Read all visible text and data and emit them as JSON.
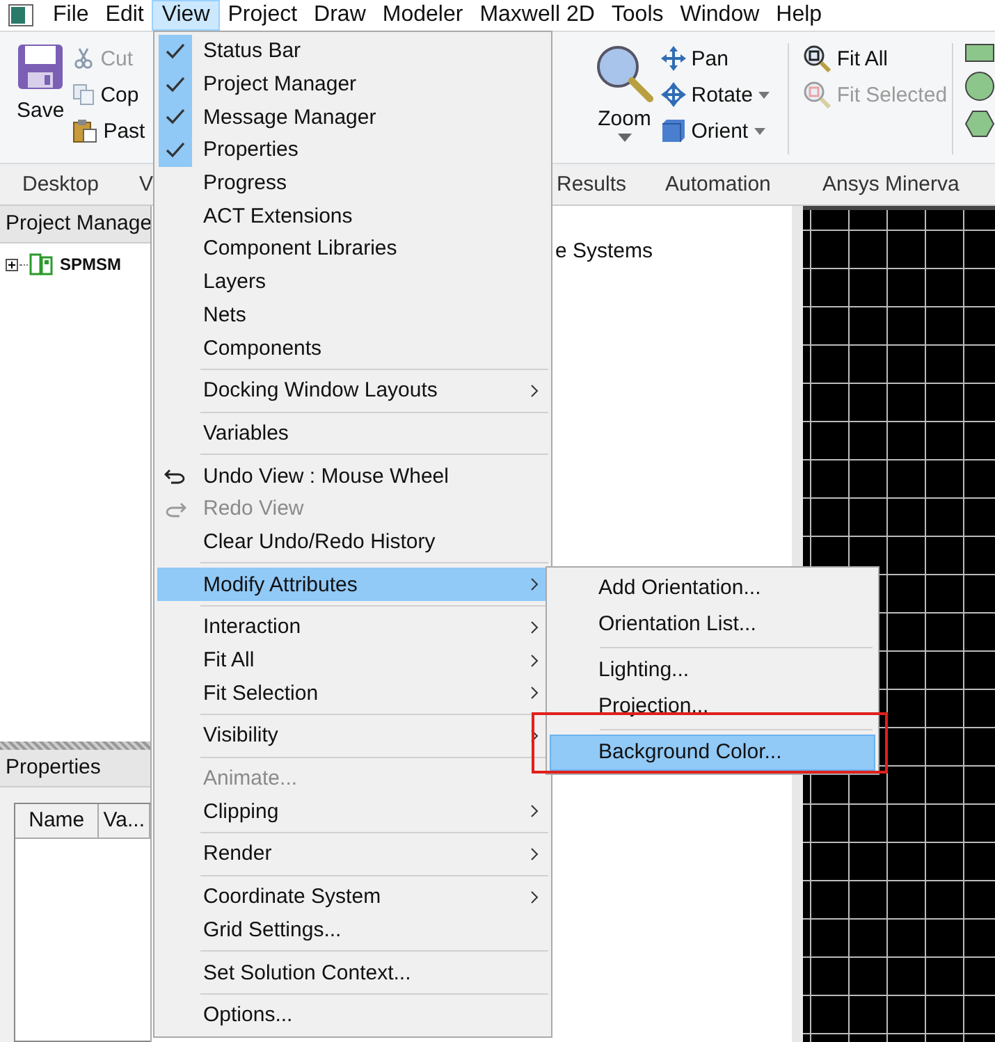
{
  "menu_bar": [
    {
      "label": "File",
      "selected": false
    },
    {
      "label": "Edit",
      "selected": false
    },
    {
      "label": "View",
      "selected": true
    },
    {
      "label": "Project",
      "selected": false
    },
    {
      "label": "Draw",
      "selected": false
    },
    {
      "label": "Modeler",
      "selected": false
    },
    {
      "label": "Maxwell 2D",
      "selected": false
    },
    {
      "label": "Tools",
      "selected": false
    },
    {
      "label": "Window",
      "selected": false
    },
    {
      "label": "Help",
      "selected": false
    }
  ],
  "ribbon": {
    "save": "Save",
    "clipboard": [
      {
        "label": "Cut",
        "disabled": true
      },
      {
        "label": "Cop",
        "disabled": false
      },
      {
        "label": "Past",
        "disabled": false
      }
    ],
    "zoom": {
      "label": "Zoom",
      "dropdown": true
    },
    "navigate": [
      {
        "label": "Pan",
        "dropdown": false
      },
      {
        "label": "Rotate",
        "dropdown": true
      },
      {
        "label": "Orient",
        "dropdown": true
      }
    ],
    "fit": [
      {
        "label": "Fit All",
        "disabled": false
      },
      {
        "label": "Fit Selected",
        "disabled": true
      }
    ]
  },
  "ribbon_tabs": [
    "Desktop",
    "V",
    "Results",
    "Automation",
    "Ansys Minerva"
  ],
  "project_manager": {
    "title": "Project Manage",
    "tree": [
      {
        "label": "SPMSM",
        "expanded": false
      }
    ]
  },
  "canvas_text": "e Systems",
  "properties": {
    "title": "Properties",
    "columns": [
      "Name",
      "Va..."
    ]
  },
  "view_menu": [
    {
      "kind": "check",
      "label": "Status Bar",
      "checked": true,
      "disabled": false,
      "submenu": false,
      "selected": false
    },
    {
      "kind": "check",
      "label": "Project Manager",
      "checked": true,
      "disabled": false,
      "submenu": false,
      "selected": false
    },
    {
      "kind": "check",
      "label": "Message Manager",
      "checked": true,
      "disabled": false,
      "submenu": false,
      "selected": false
    },
    {
      "kind": "check",
      "label": "Properties",
      "checked": true,
      "disabled": false,
      "submenu": false,
      "selected": false
    },
    {
      "kind": "check",
      "label": "Progress",
      "checked": false,
      "disabled": false,
      "submenu": false,
      "selected": false
    },
    {
      "kind": "check",
      "label": "ACT Extensions",
      "checked": false,
      "disabled": false,
      "submenu": false,
      "selected": false
    },
    {
      "kind": "check",
      "label": "Component Libraries",
      "checked": false,
      "disabled": false,
      "submenu": false,
      "selected": false
    },
    {
      "kind": "check",
      "label": "Layers",
      "checked": false,
      "disabled": false,
      "submenu": false,
      "selected": false
    },
    {
      "kind": "check",
      "label": "Nets",
      "checked": false,
      "disabled": false,
      "submenu": false,
      "selected": false
    },
    {
      "kind": "check",
      "label": "Components",
      "checked": false,
      "disabled": false,
      "submenu": false,
      "selected": false
    },
    {
      "kind": "separator"
    },
    {
      "kind": "item",
      "label": "Docking Window Layouts",
      "disabled": false,
      "submenu": true,
      "selected": false
    },
    {
      "kind": "separator"
    },
    {
      "kind": "item",
      "label": "Variables",
      "disabled": false,
      "submenu": false,
      "selected": false
    },
    {
      "kind": "separator"
    },
    {
      "kind": "undo",
      "label": "Undo View : Mouse Wheel",
      "disabled": false,
      "submenu": false,
      "selected": false
    },
    {
      "kind": "redo",
      "label": "Redo View",
      "disabled": true,
      "submenu": false,
      "selected": false
    },
    {
      "kind": "item",
      "label": "Clear Undo/Redo History",
      "disabled": false,
      "submenu": false,
      "selected": false
    },
    {
      "kind": "separator"
    },
    {
      "kind": "item",
      "label": "Modify Attributes",
      "disabled": false,
      "submenu": true,
      "selected": true
    },
    {
      "kind": "separator"
    },
    {
      "kind": "item",
      "label": "Interaction",
      "disabled": false,
      "submenu": true,
      "selected": false
    },
    {
      "kind": "item",
      "label": "Fit All",
      "disabled": false,
      "submenu": true,
      "selected": false
    },
    {
      "kind": "item",
      "label": "Fit Selection",
      "disabled": false,
      "submenu": true,
      "selected": false
    },
    {
      "kind": "separator"
    },
    {
      "kind": "item",
      "label": "Visibility",
      "disabled": false,
      "submenu": true,
      "selected": false
    },
    {
      "kind": "separator"
    },
    {
      "kind": "item",
      "label": "Animate...",
      "disabled": true,
      "submenu": false,
      "selected": false
    },
    {
      "kind": "item",
      "label": "Clipping",
      "disabled": false,
      "submenu": true,
      "selected": false
    },
    {
      "kind": "separator"
    },
    {
      "kind": "item",
      "label": "Render",
      "disabled": false,
      "submenu": true,
      "selected": false
    },
    {
      "kind": "separator"
    },
    {
      "kind": "item",
      "label": "Coordinate System",
      "disabled": false,
      "submenu": true,
      "selected": false
    },
    {
      "kind": "item",
      "label": "Grid Settings...",
      "disabled": false,
      "submenu": false,
      "selected": false
    },
    {
      "kind": "separator"
    },
    {
      "kind": "item",
      "label": "Set Solution Context...",
      "disabled": false,
      "submenu": false,
      "selected": false
    },
    {
      "kind": "separator"
    },
    {
      "kind": "item",
      "label": "Options...",
      "disabled": false,
      "submenu": false,
      "selected": false
    }
  ],
  "submenu": [
    {
      "kind": "item",
      "label": "Add Orientation...",
      "selected": false
    },
    {
      "kind": "item",
      "label": "Orientation List...",
      "selected": false
    },
    {
      "kind": "separator"
    },
    {
      "kind": "item",
      "label": "Lighting...",
      "selected": false
    },
    {
      "kind": "item",
      "label": "Projection...",
      "selected": false
    },
    {
      "kind": "separator"
    },
    {
      "kind": "item",
      "label": "Background Color...",
      "selected": true
    }
  ]
}
